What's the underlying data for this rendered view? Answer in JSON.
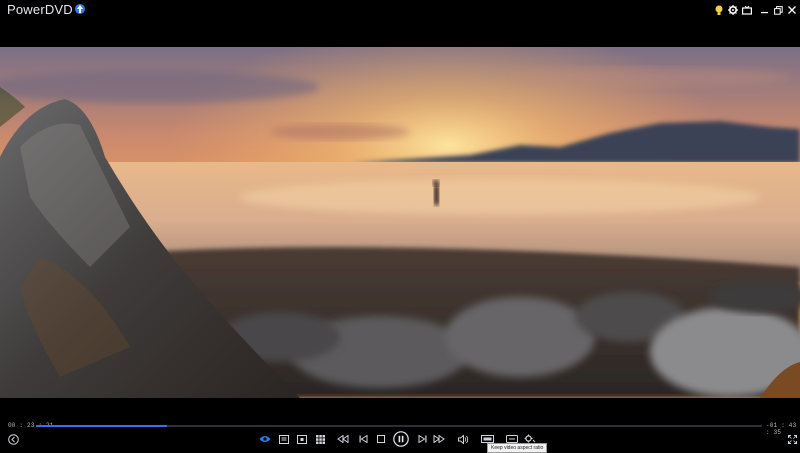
{
  "window": {
    "title": "PowerDVD"
  },
  "icons": {
    "update": "arrow-up-icon",
    "tips": "lightbulb-icon",
    "settings": "gear-icon",
    "tv_mode": "tv-icon",
    "minimize": "minimize-icon",
    "restore": "restore-icon",
    "close": "close-icon"
  },
  "playback": {
    "elapsed": "00 : 23 : 21",
    "remaining": "-01 : 43 : 35",
    "progress_fraction": 0.18
  },
  "tooltip": {
    "text": "Keep video aspect ratio"
  },
  "colors": {
    "accent": "#3a6df0",
    "background": "#000000"
  }
}
